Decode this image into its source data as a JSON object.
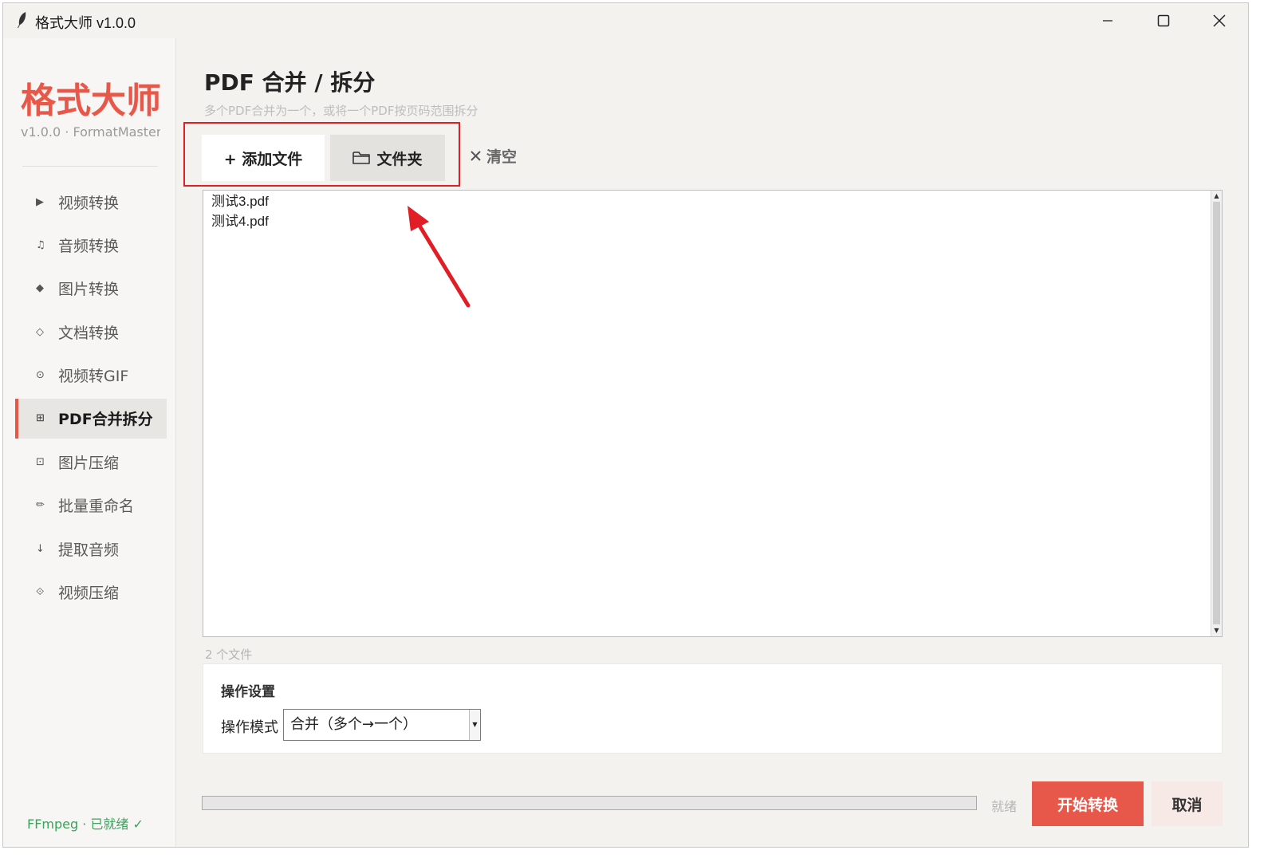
{
  "window": {
    "title": "格式大师 v1.0.0"
  },
  "sidebar": {
    "brand": "格式大师",
    "version": "v1.0.0 · FormatMaster",
    "items": [
      {
        "icon": "▶",
        "label": "视频转换",
        "icon_name": "play-icon"
      },
      {
        "icon": "♫",
        "label": "音频转换",
        "icon_name": "music-note-icon"
      },
      {
        "icon": "◆",
        "label": "图片转换",
        "icon_name": "diamond-icon"
      },
      {
        "icon": "◇",
        "label": "文档转换",
        "icon_name": "diamond-outline-icon"
      },
      {
        "icon": "⊙",
        "label": "视频转GIF",
        "icon_name": "circle-dot-icon"
      },
      {
        "icon": "⊞",
        "label": "PDF合并拆分",
        "icon_name": "grid-icon",
        "active": true
      },
      {
        "icon": "⊡",
        "label": "图片压缩",
        "icon_name": "square-dot-icon"
      },
      {
        "icon": "✏",
        "label": "批量重命名",
        "icon_name": "pencil-icon"
      },
      {
        "icon": "↓",
        "label": "提取音频",
        "icon_name": "down-arrow-icon"
      },
      {
        "icon": "⟐",
        "label": "视频压缩",
        "icon_name": "compress-icon"
      }
    ],
    "ffmpeg_status": "FFmpeg · 已就绪 ✓"
  },
  "main": {
    "title": "PDF 合并 / 拆分",
    "subtitle": "多个PDF合并为一个，或将一个PDF按页码范围拆分",
    "toolbar": {
      "add_label": "+  添加文件",
      "folder_label": "文件夹",
      "clear_label": "清空"
    },
    "files": [
      "测试3.pdf",
      "测试4.pdf"
    ],
    "file_count": "2 个文件",
    "settings": {
      "title": "操作设置",
      "mode_label": "操作模式",
      "mode_value": "合并（多个→一个）"
    },
    "progress": 0,
    "status": "就绪",
    "start_label": "开始转换",
    "cancel_label": "取消"
  },
  "colors": {
    "accent": "#e8584a",
    "highlight": "#e11d26",
    "ok": "#3aa35c"
  }
}
